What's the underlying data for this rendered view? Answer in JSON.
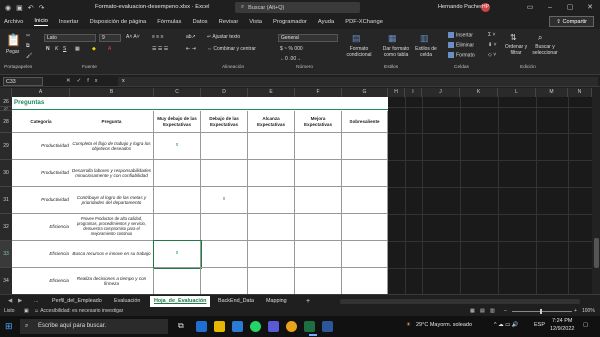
{
  "title_bar": {
    "doc_title": "Formato-evaluacion-desempeno.xlsx  ·  Excel",
    "search_placeholder": "Buscar (Alt+Q)",
    "user": "Hernando Pacheco",
    "user_initials": "HP"
  },
  "menu": {
    "items": [
      "Archivo",
      "Inicio",
      "Insertar",
      "Disposición de página",
      "Fórmulas",
      "Datos",
      "Revisar",
      "Vista",
      "Programador",
      "Ayuda",
      "PDF-XChange"
    ],
    "active": "Inicio",
    "share": "Compartir"
  },
  "ribbon": {
    "paste": "Pegar",
    "font_name": "Lato",
    "font_size": "9",
    "wrap": "Ajustar texto",
    "merge": "Combinar y centrar",
    "number_format": "General",
    "cond_format": "Formato condicional",
    "format_table": "Dar formato como tabla",
    "cell_styles": "Estilos de celda",
    "insert": "Insertar",
    "delete": "Eliminar",
    "format": "Formato",
    "sort": "Ordenar y filtrar",
    "find": "Buscar y seleccionar",
    "groups": [
      "Portapapeles",
      "Fuente",
      "Alineación",
      "Número",
      "Estilos",
      "Celdas",
      "Edición"
    ]
  },
  "formula_bar": {
    "name_box": "C33",
    "fx": "fx",
    "content": "x"
  },
  "columns": [
    "A",
    "B",
    "C",
    "D",
    "E",
    "F",
    "G",
    "H",
    "I",
    "J",
    "K",
    "L",
    "M",
    "N"
  ],
  "rows": [
    "26",
    "27",
    "28",
    "29",
    "30",
    "31",
    "32",
    "33",
    "34",
    "35"
  ],
  "sheet": {
    "section_title": "Preguntas",
    "headers": {
      "categoria": "Categoría",
      "pregunta": "Pregunta",
      "c1": "Muy debajo de las Expectativas",
      "c2": "Debajo de las Expectativas",
      "c3": "Alcanza Expectativas",
      "c4": "Mejora Expectativas",
      "c5": "Sobresaliente"
    },
    "rows": [
      {
        "cat": "Productividad",
        "q": "Completa el flujo de trabajo y logra los objetivos deseados",
        "mark": "x",
        "mark_col": 1
      },
      {
        "cat": "Productividad",
        "q": "Desarrolla labores y responsabilidades minuciosamente y con confiabilidad",
        "mark": "",
        "mark_col": 0
      },
      {
        "cat": "Productividad",
        "q": "Contribuye al logro de las metas y prioridades del departamento",
        "mark": "x",
        "mark_col": 2
      },
      {
        "cat": "Eficiencia",
        "q": "Provee Productos de alta calidad, programas, procedimientos y servicio, demuestra compromiso para el mejoramiento continuo",
        "mark": "",
        "mark_col": 0
      },
      {
        "cat": "Eficiencia",
        "q": "Busca recursos e innove en su trabajo",
        "mark": "x",
        "mark_col": 1
      },
      {
        "cat": "Eficiencia",
        "q": "Realiza decisiones a tiempo y con firmeza",
        "mark": "",
        "mark_col": 0
      }
    ]
  },
  "tabs": {
    "nav": "...",
    "items": [
      "Perfil_del_Empleado",
      "Evaluación",
      "Hoja_de_Evaluación",
      "BackEnd_Data",
      "Mapping"
    ],
    "active": "Hoja_de_Evaluación",
    "add": "+"
  },
  "status": {
    "mode": "Listo",
    "accessibility": "Accesibilidad: es necesario investigar",
    "zoom": "100%"
  },
  "taskbar": {
    "search": "Escribe aquí para buscar.",
    "weather": "29°C  Mayorm. soleado",
    "lang": "ESP",
    "time": "7:24 PM",
    "date": "12/9/2022"
  }
}
